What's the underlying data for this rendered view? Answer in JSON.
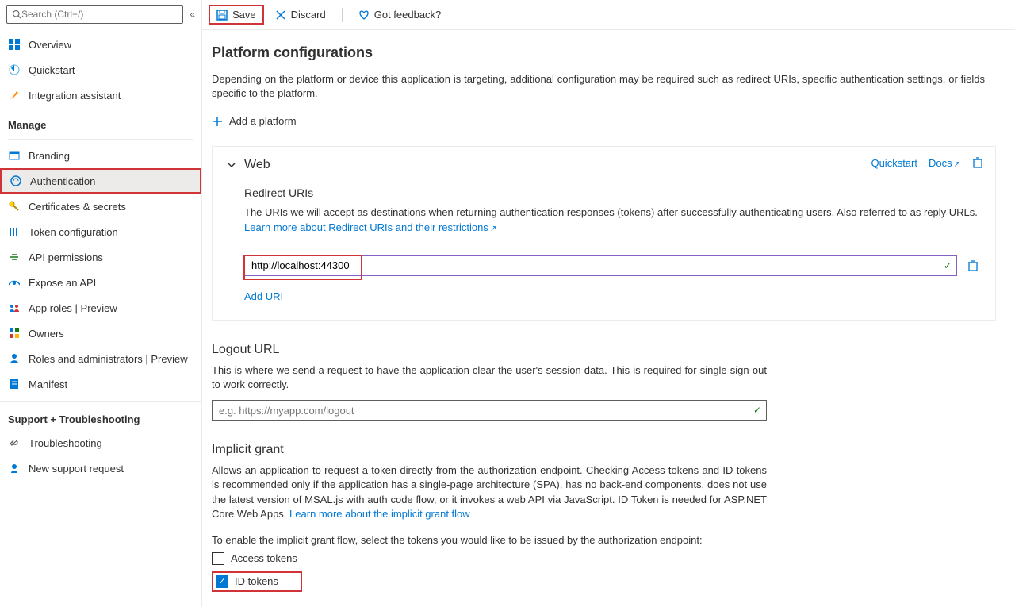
{
  "search": {
    "placeholder": "Search (Ctrl+/)"
  },
  "sidebar": {
    "items": [
      {
        "label": "Overview"
      },
      {
        "label": "Quickstart"
      },
      {
        "label": "Integration assistant"
      }
    ],
    "manage_title": "Manage",
    "manage_items": [
      {
        "label": "Branding"
      },
      {
        "label": "Authentication"
      },
      {
        "label": "Certificates & secrets"
      },
      {
        "label": "Token configuration"
      },
      {
        "label": "API permissions"
      },
      {
        "label": "Expose an API"
      },
      {
        "label": "App roles | Preview"
      },
      {
        "label": "Owners"
      },
      {
        "label": "Roles and administrators | Preview"
      },
      {
        "label": "Manifest"
      }
    ],
    "support_title": "Support + Troubleshooting",
    "support_items": [
      {
        "label": "Troubleshooting"
      },
      {
        "label": "New support request"
      }
    ]
  },
  "toolbar": {
    "save": "Save",
    "discard": "Discard",
    "feedback": "Got feedback?"
  },
  "platform": {
    "title": "Platform configurations",
    "description": "Depending on the platform or device this application is targeting, additional configuration may be required such as redirect URIs, specific authentication settings, or fields specific to the platform.",
    "add": "Add a platform"
  },
  "web_panel": {
    "title": "Web",
    "quickstart": "Quickstart",
    "docs": "Docs",
    "redirect_title": "Redirect URIs",
    "redirect_text": "The URIs we will accept as destinations when returning authentication responses (tokens) after successfully authenticating users. Also referred to as reply URLs. ",
    "redirect_link": "Learn more about Redirect URIs and their restrictions",
    "uri_value": "http://localhost:44300",
    "add_uri": "Add URI"
  },
  "logout": {
    "title": "Logout URL",
    "text": "This is where we send a request to have the application clear the user's session data. This is required for single sign-out to work correctly.",
    "placeholder": "e.g. https://myapp.com/logout"
  },
  "implicit": {
    "title": "Implicit grant",
    "text": "Allows an application to request a token directly from the authorization endpoint. Checking Access tokens and ID tokens is recommended only if the application has a single-page architecture (SPA), has no back-end components, does not use the latest version of MSAL.js with auth code flow, or it invokes a web API via JavaScript. ID Token is needed for ASP.NET Core Web Apps. ",
    "link": "Learn more about the implicit grant flow",
    "enable_text": "To enable the implicit grant flow, select the tokens you would like to be issued by the authorization endpoint:",
    "access_tokens": "Access tokens",
    "id_tokens": "ID tokens"
  }
}
